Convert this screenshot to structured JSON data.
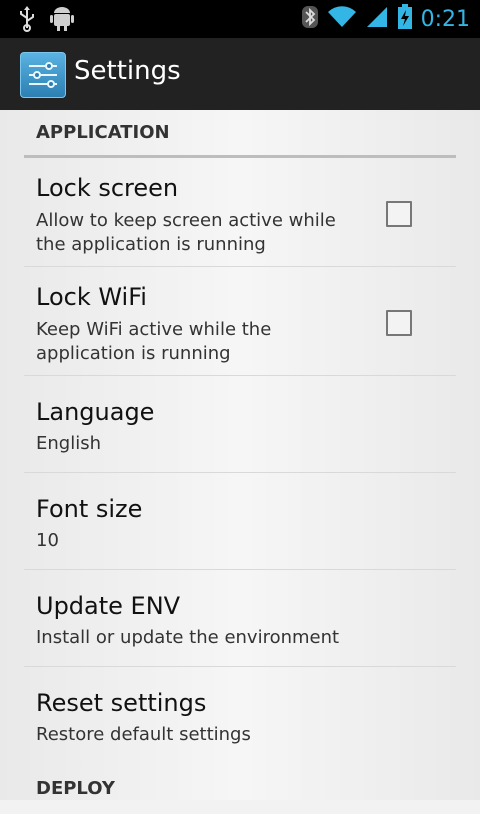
{
  "status_bar": {
    "icons": [
      "usb-icon",
      "android-debug-icon",
      "bluetooth-icon",
      "wifi-icon",
      "signal-icon",
      "battery-charging-icon"
    ],
    "time": "0:21"
  },
  "action_bar": {
    "icon": "settings-app-icon",
    "title": "Settings"
  },
  "sections": {
    "application": {
      "header": "APPLICATION",
      "items": [
        {
          "title": "Lock screen",
          "summary": "Allow to keep screen active while the application is running",
          "checked": false
        },
        {
          "title": "Lock WiFi",
          "summary": "Keep WiFi active while the application is running",
          "checked": false
        },
        {
          "title": "Language",
          "summary": "English"
        },
        {
          "title": "Font size",
          "summary": "10"
        },
        {
          "title": "Update ENV",
          "summary": "Install or update the environment"
        },
        {
          "title": "Reset settings",
          "summary": "Restore default settings"
        }
      ]
    },
    "deploy": {
      "header": "DEPLOY"
    }
  },
  "colors": {
    "status_time": "#33b5e5",
    "action_bar_bg": "#222222",
    "list_bg": "#f2f2f2"
  }
}
